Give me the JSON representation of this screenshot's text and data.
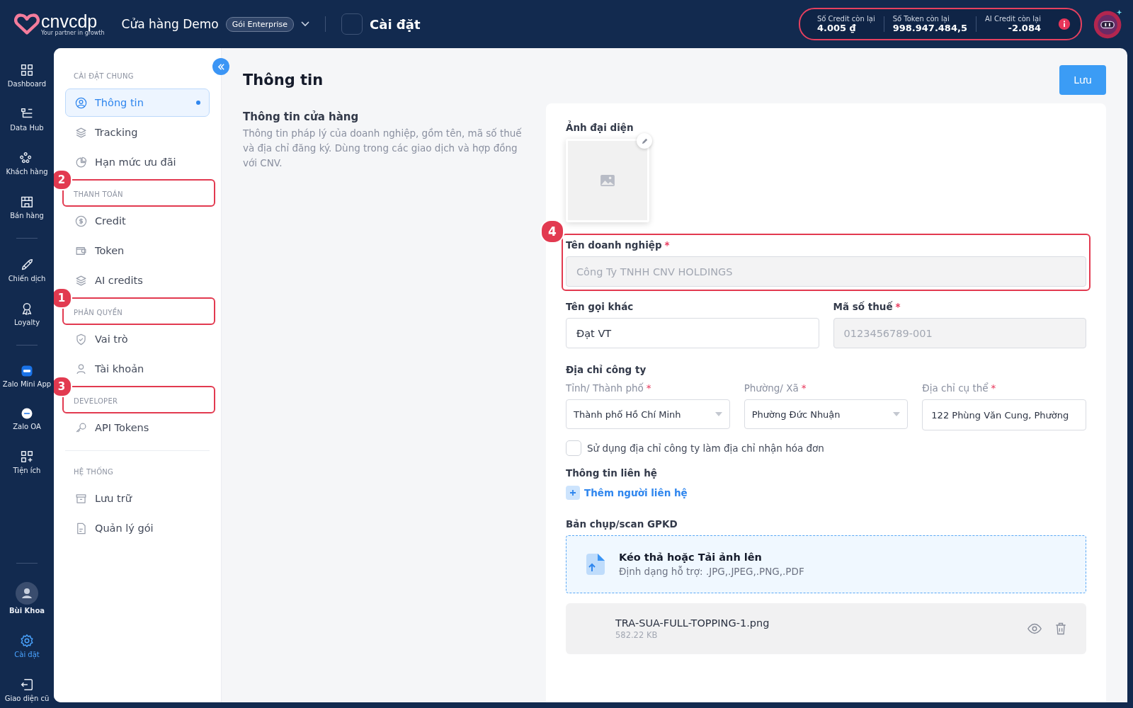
{
  "brand": {
    "name": "cnvcdp",
    "tagline": "Your partner in growth"
  },
  "topbar": {
    "store": "Cửa hàng Demo",
    "plan": "Gói Enterprise",
    "page": "Cài đặt"
  },
  "balances": [
    {
      "label": "Số Credit còn lại",
      "value": "4.005 ₫"
    },
    {
      "label": "Số Token còn lại",
      "value": "998.947.484,5"
    },
    {
      "label": "AI Credit còn lại",
      "value": "-2.084"
    }
  ],
  "rail": {
    "groups": [
      [
        {
          "label": "Dashboard",
          "selected": false
        },
        {
          "label": "Data Hub",
          "selected": false
        },
        {
          "label": "Khách hàng",
          "selected": false
        },
        {
          "label": "Bán hàng",
          "selected": false
        }
      ],
      [
        {
          "label": "Chiến dịch",
          "selected": false
        },
        {
          "label": "Loyalty",
          "selected": false
        }
      ],
      [
        {
          "label": "Zalo Mini App",
          "selected": false
        },
        {
          "label": "Zalo OA",
          "selected": false
        },
        {
          "label": "Tiện ích",
          "selected": false
        }
      ]
    ],
    "user": "Bùi Khoa",
    "bottom": [
      {
        "label": "Cài đặt",
        "selected": true
      },
      {
        "label": "Giao diện cũ",
        "selected": false
      }
    ]
  },
  "settings_nav": [
    {
      "title": "CÀI ĐẶT CHUNG",
      "items": [
        {
          "label": "Thông tin",
          "selected": true
        },
        {
          "label": "Tracking",
          "selected": false
        },
        {
          "label": "Hạn mức ưu đãi",
          "selected": false
        }
      ]
    },
    {
      "title": "THANH TOÁN",
      "marker": "2",
      "items": [
        {
          "label": "Credit",
          "selected": false
        },
        {
          "label": "Token",
          "selected": false
        },
        {
          "label": "AI credits",
          "selected": false
        }
      ]
    },
    {
      "title": "PHÂN QUYỀN",
      "marker": "1",
      "items": [
        {
          "label": "Vai trò",
          "selected": false
        },
        {
          "label": "Tài khoản",
          "selected": false
        }
      ]
    },
    {
      "title": "DEVELOPER",
      "marker": "3",
      "items": [
        {
          "label": "API Tokens",
          "selected": false
        }
      ]
    },
    {
      "title": "HỆ THỐNG",
      "items": [
        {
          "label": "Lưu trữ",
          "selected": false
        },
        {
          "label": "Quản lý gói",
          "selected": false
        }
      ]
    }
  ],
  "page": {
    "title": "Thông tin",
    "save": "Lưu",
    "section_title": "Thông tin cửa hàng",
    "section_desc": "Thông tin pháp lý của doanh nghiệp, gồm tên, mã số thuế và địa chỉ đăng ký. Dùng trong các giao dịch và hợp đồng với CNV."
  },
  "form": {
    "avatar_label": "Ảnh đại diện",
    "business_name": {
      "label": "Tên doanh nghiệp",
      "required_mark": "*",
      "value": "Công Ty TNHH CNV HOLDINGS",
      "disabled": true,
      "marker": "4"
    },
    "row": [
      {
        "label": "Tên gọi khác",
        "value": "Đạt VT",
        "disabled": false
      },
      {
        "label": "Mã số thuế",
        "required_mark": "*",
        "value": "0123456789-001",
        "disabled": true
      }
    ],
    "address_title": "Địa chỉ công ty",
    "address": [
      {
        "label": "Tỉnh/ Thành phố",
        "required_mark": "*",
        "value": "Thành phố Hồ Chí Minh",
        "kind": "select"
      },
      {
        "label": "Phường/ Xã",
        "required_mark": "*",
        "value": "Phường Đức Nhuận",
        "kind": "select"
      },
      {
        "label": "Địa chỉ cụ thể",
        "required_mark": "*",
        "value": "122 Phùng Văn Cung, Phường",
        "kind": "text"
      }
    ],
    "billing_checkbox": {
      "label": "Sử dụng địa chỉ công ty làm địa chỉ nhận hóa đơn",
      "checked": false
    },
    "contact_title": "Thông tin liên hệ",
    "add_contact": "Thêm người liên hệ",
    "license_title": "Bản chụp/scan GPKD",
    "upload": {
      "text": "Kéo thả hoặc **Tải ảnh lên**",
      "formats": "Định dạng hỗ trợ: .JPG,.JPEG,.PNG,.PDF"
    },
    "file": {
      "name": "TRA-SUA-FULL-TOPPING-1.png",
      "size": "582.22 KB"
    }
  }
}
